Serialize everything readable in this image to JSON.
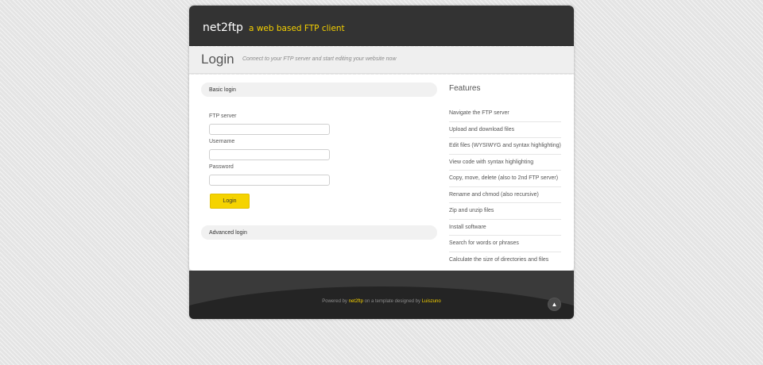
{
  "header": {
    "app_name": "net2ftp",
    "tagline": "a web based FTP client"
  },
  "title_bar": {
    "title": "Login",
    "subtitle": "Connect to your FTP server and start editing your website now"
  },
  "basic_login": {
    "header": "Basic login",
    "ftp_server_label": "FTP server",
    "ftp_server_value": "",
    "username_label": "Username",
    "username_value": "",
    "password_label": "Password",
    "password_value": "",
    "login_button": "Login"
  },
  "advanced_login": {
    "header": "Advanced login"
  },
  "features": {
    "title": "Features",
    "items": [
      "Navigate the FTP server",
      "Upload and download files",
      "Edit files (WYSIWYG and syntax highlighting)",
      "View code with syntax highlighting",
      "Copy, move, delete (also to 2nd FTP server)",
      "Rename and chmod (also recursive)",
      "Zip and unzip files",
      "Install software",
      "Search for words or phrases",
      "Calculate the size of directories and files"
    ]
  },
  "footer": {
    "powered_by": "Powered by",
    "net2ftp_link": "net2ftp",
    "template_text": "on a template designed by",
    "designer_link": "Luiszuno",
    "to_top_icon": "arrow-up-icon"
  },
  "colors": {
    "accent": "#f5d000",
    "header_bg": "#333333",
    "footer_bg": "#3a3a3a"
  }
}
